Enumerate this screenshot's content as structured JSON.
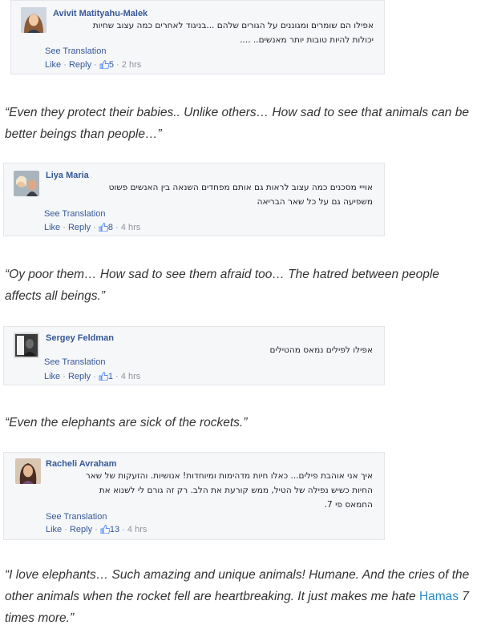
{
  "comments": [
    {
      "author": "Avivit Matityahu-Malek",
      "lines": [
        "אפילו הם שומרים ומגוננים על הגורים שלהם ...בניגוד לאחרים כמה עצוב שחיות",
        "יכולות להיות טובות יותר מאנשים.. ...."
      ],
      "see_translation": "See Translation",
      "like": "Like",
      "reply": "Reply",
      "likes": "5",
      "time": "2 hrs",
      "quote": "“Even they protect their babies.. Unlike others… How sad to see that animals can be better beings than people…”"
    },
    {
      "author": "Liya Maria",
      "lines": [
        "אוייי מסכנים כמה עצוב לראות גם אותם מפחדים השנאה בין האנשים פשוט",
        "משפיעה גם על כל שאר הבריאה"
      ],
      "see_translation": "See Translation",
      "like": "Like",
      "reply": "Reply",
      "likes": "8",
      "time": "4 hrs",
      "quote": "“Oy poor them… How sad to see them afraid too… The hatred between people affects all beings.”"
    },
    {
      "author": "Sergey Feldman",
      "lines": [
        "אפילו לפילים נמאס מהטילים"
      ],
      "see_translation": "See Translation",
      "like": "Like",
      "reply": "Reply",
      "likes": "1",
      "time": "4 hrs",
      "quote": "“Even the elephants are sick of the rockets.”"
    },
    {
      "author": "Racheli Avraham",
      "lines": [
        "איך אני אוהבת פילים... כאלו חיות מדהימות ומיוחדות! אנושיות. והזעקות של שאר",
        "החיות כשיש נפילה של הטיל, ממש קורעת את הלב. רק זה גורם לי לשנוא את",
        "החמאס פי 7."
      ],
      "see_translation": "See Translation",
      "like": "Like",
      "reply": "Reply",
      "likes": "13",
      "time": "4 hrs",
      "quote_before": "“I love elephants… Such amazing and unique animals! Humane. And the cries of the other animals when the rocket fell are heartbreaking. It just makes me hate ",
      "quote_link": "Hamas",
      "quote_after": " 7 times more.”"
    }
  ],
  "separator": " · ",
  "colors": {
    "link": "#365899",
    "muted": "#90949c",
    "quote": "#333333",
    "highlight": "#2a8cc9",
    "card_bg": "#f6f7f9"
  },
  "icons": {
    "like": "thumbs-up-icon"
  }
}
